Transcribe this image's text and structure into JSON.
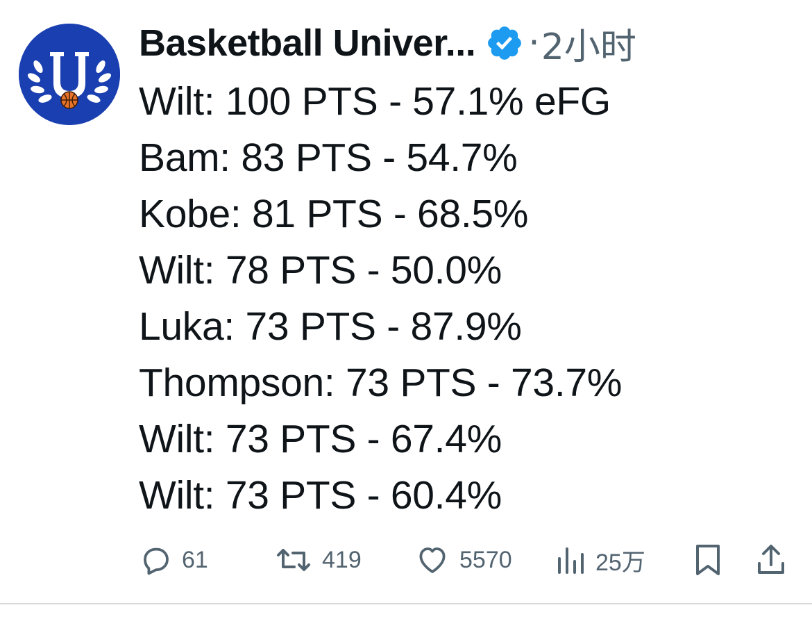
{
  "author": {
    "name": "Basketball Univer...",
    "avatar_icon": "basketball-university-logo",
    "verified_icon": "verified-badge-icon",
    "separator": "·",
    "time": "2小时"
  },
  "tweet": {
    "lines": [
      "Wilt: 100 PTS - 57.1% eFG",
      "Bam: 83 PTS - 54.7%",
      "Kobe: 81 PTS - 68.5%",
      "Wilt: 78 PTS - 50.0%",
      "Luka: 73 PTS - 87.9%",
      "Thompson: 73 PTS - 73.7%",
      "Wilt: 73 PTS - 67.4%",
      "Wilt: 73 PTS - 60.4%"
    ]
  },
  "actions": {
    "reply": {
      "icon": "reply-icon",
      "count": "61"
    },
    "retweet": {
      "icon": "retweet-icon",
      "count": "419"
    },
    "like": {
      "icon": "heart-icon",
      "count": "5570"
    },
    "views": {
      "icon": "views-icon",
      "count": "25万"
    },
    "bookmark": {
      "icon": "bookmark-icon"
    },
    "share": {
      "icon": "share-icon"
    }
  },
  "colors": {
    "avatar_bg": "#1a3fb0",
    "verified": "#1d9bf0",
    "text": "#0f1419",
    "muted": "#536471"
  }
}
